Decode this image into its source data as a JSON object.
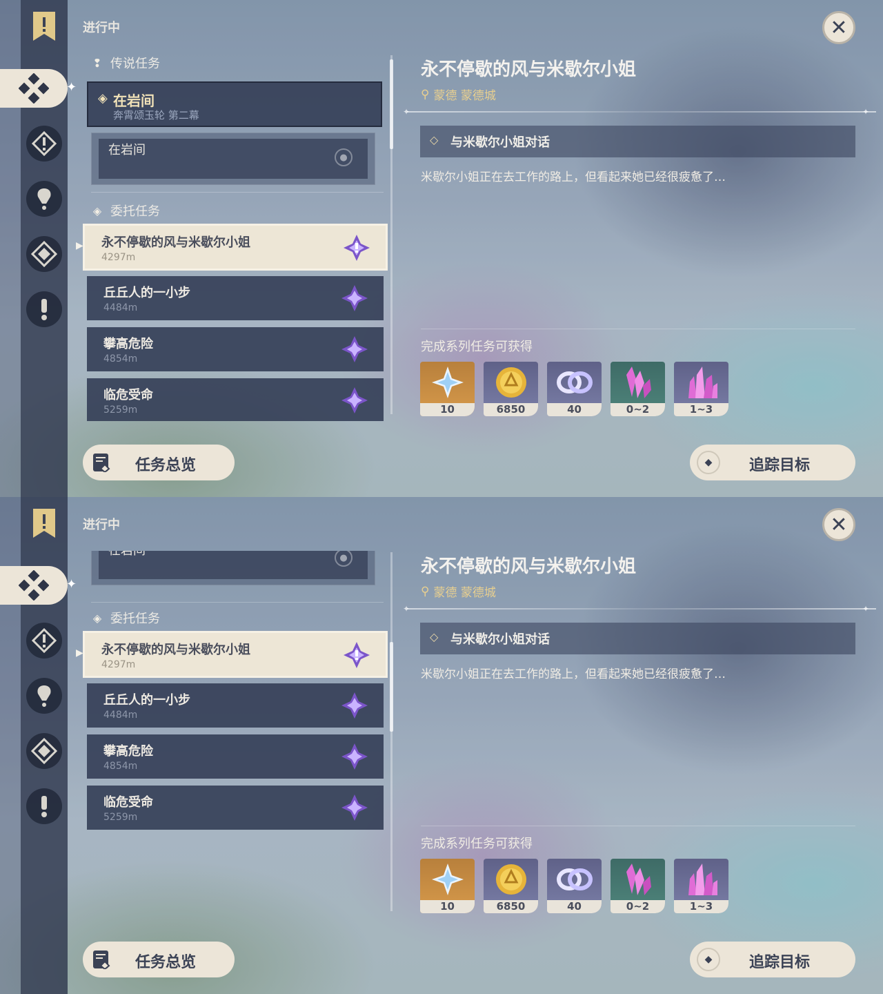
{
  "status_label": "进行中",
  "legend_section": "传说任务",
  "legend_quest": {
    "title": "在岩间",
    "subtitle": "奔霄颂玉轮 第二幕",
    "sub_step": "在岩间"
  },
  "commission_section": "委托任务",
  "quests": [
    {
      "title": "永不停歇的风与米歇尔小姐",
      "distance": "4297m",
      "selected": true
    },
    {
      "title": "丘丘人的一小步",
      "distance": "4484m",
      "selected": false
    },
    {
      "title": "攀高危险",
      "distance": "4854m",
      "selected": false
    },
    {
      "title": "临危受命",
      "distance": "5259m",
      "selected": false
    }
  ],
  "detail": {
    "title": "永不停歇的风与米歇尔小姐",
    "location": "蒙德 蒙德城",
    "objective": "与米歇尔小姐对话",
    "description": "米歇尔小姐正在去工作的路上，但看起来她已经很疲惫了…",
    "rewards_label": "完成系列任务可获得",
    "rewards": [
      {
        "icon": "primogem-icon",
        "count": "10"
      },
      {
        "icon": "mora-icon",
        "count": "6850"
      },
      {
        "icon": "friendship-exp-icon",
        "count": "40"
      },
      {
        "icon": "crystal-chunk-icon",
        "count": "0~2"
      },
      {
        "icon": "crystal-cluster-icon",
        "count": "1~3"
      }
    ]
  },
  "buttons": {
    "overview": "任务总览",
    "track": "追踪目标"
  },
  "colors": {
    "panel_cream": "#ece5d8",
    "rail": "#30384e",
    "accent_gold": "#e8cf8f"
  }
}
